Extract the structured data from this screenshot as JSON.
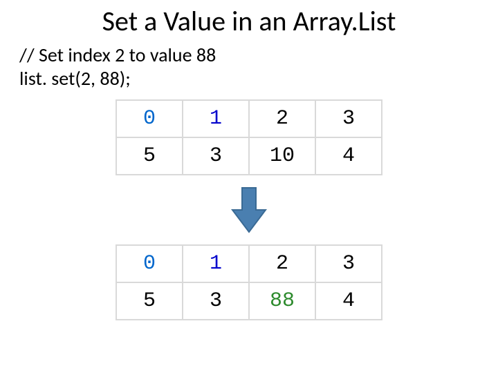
{
  "title": "Set a Value in an Array.List",
  "code_comment": "// Set index 2 to value 88",
  "code_line": "list. set(2, 88);",
  "before": {
    "indices": [
      "0",
      "1",
      "2",
      "3"
    ],
    "values": [
      "5",
      "3",
      "10",
      "4"
    ]
  },
  "after": {
    "indices": [
      "0",
      "1",
      "2",
      "3"
    ],
    "values": [
      "5",
      "3",
      "88",
      "4"
    ]
  },
  "changed_index": 2,
  "colors": {
    "arrow_fill": "#4a7fb0",
    "arrow_stroke": "#3a6a94"
  }
}
